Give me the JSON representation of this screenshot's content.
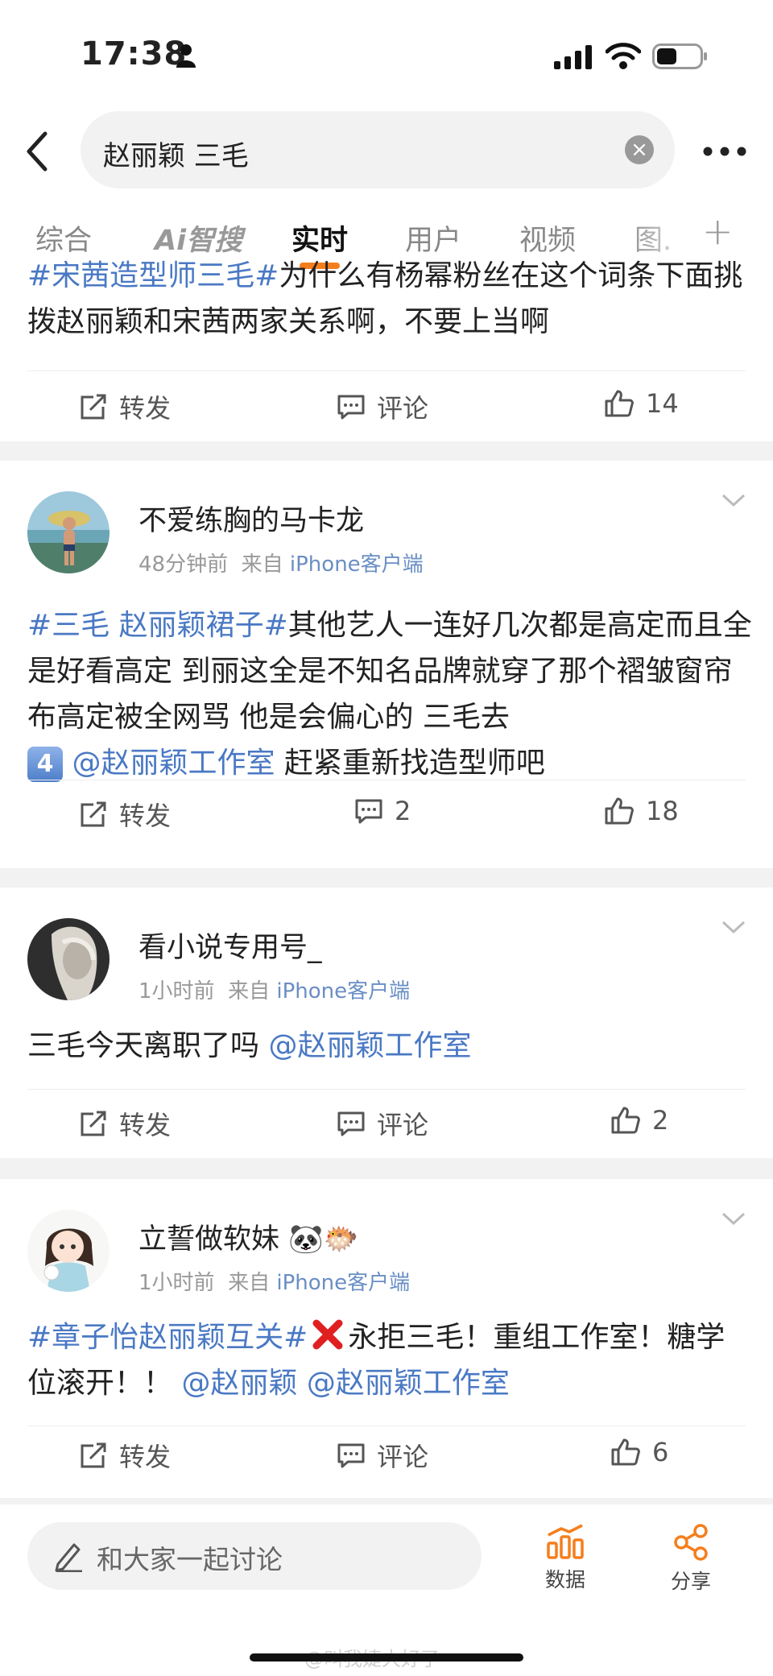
{
  "status": {
    "time": "17:38"
  },
  "search": {
    "query": "赵丽颖 三毛",
    "clear_icon": "clear-icon",
    "back_icon": "back-icon",
    "more_icon": "more-dots-icon"
  },
  "tabs": [
    {
      "label": "综合",
      "active": false
    },
    {
      "label": "Ai智搜",
      "active": false
    },
    {
      "label": "实时",
      "active": true
    },
    {
      "label": "用户",
      "active": false
    },
    {
      "label": "视频",
      "active": false
    },
    {
      "label": "图.",
      "active": false
    }
  ],
  "tab_plus": "+",
  "posts": [
    {
      "partial": true,
      "text_tag": "#宋茜造型师三毛#",
      "text_body": "为什么有杨幂粉丝在这个词条下面挑拨赵丽颖和宋茜两家关系啊，不要上当啊",
      "repost_label": "转发",
      "comment_label": "评论",
      "likes": "14"
    },
    {
      "username": "不爱练胸的马卡龙",
      "time": "48分钟前",
      "from_label": "来自",
      "source": "iPhone客户端",
      "tag": "#三毛 赵丽颖裙子#",
      "body1": "其他艺人一连好几次都是高定而且全是好看高定 到丽这全是不知名品牌就穿了那个褶皱窗帘布高定被全网骂 他是会偏心的 三毛去",
      "emoji": "4",
      "mention": "@赵丽颖工作室",
      "body2": " 赶紧重新找造型师吧",
      "repost_label": "转发",
      "comments": "2",
      "likes": "18"
    },
    {
      "username": "看小说专用号_",
      "time": "1小时前",
      "from_label": "来自",
      "source": "iPhone客户端",
      "body": "三毛今天离职了吗 ",
      "mention": "@赵丽颖工作室",
      "repost_label": "转发",
      "comment_label": "评论",
      "likes": "2"
    },
    {
      "username": "立誓做软妹",
      "username_emojis": "🐼🐡",
      "time": "1小时前",
      "from_label": "来自",
      "source": "iPhone客户端",
      "tag": "#章子怡赵丽颖互关#",
      "body": "永拒三毛！重组工作室！糖学位滚开！！ ",
      "mention1": "@赵丽颖",
      "mention2": "@赵丽颖工作室",
      "repost_label": "转发",
      "comment_label": "评论",
      "likes": "6"
    }
  ],
  "bottom": {
    "discuss_placeholder": "和大家一起讨论",
    "data_label": "数据",
    "share_label": "分享"
  },
  "watermark": "@叫我婕大好了",
  "colors": {
    "accent": "#f57e1c",
    "link": "#4a79c4",
    "source": "#6a8ec4"
  }
}
